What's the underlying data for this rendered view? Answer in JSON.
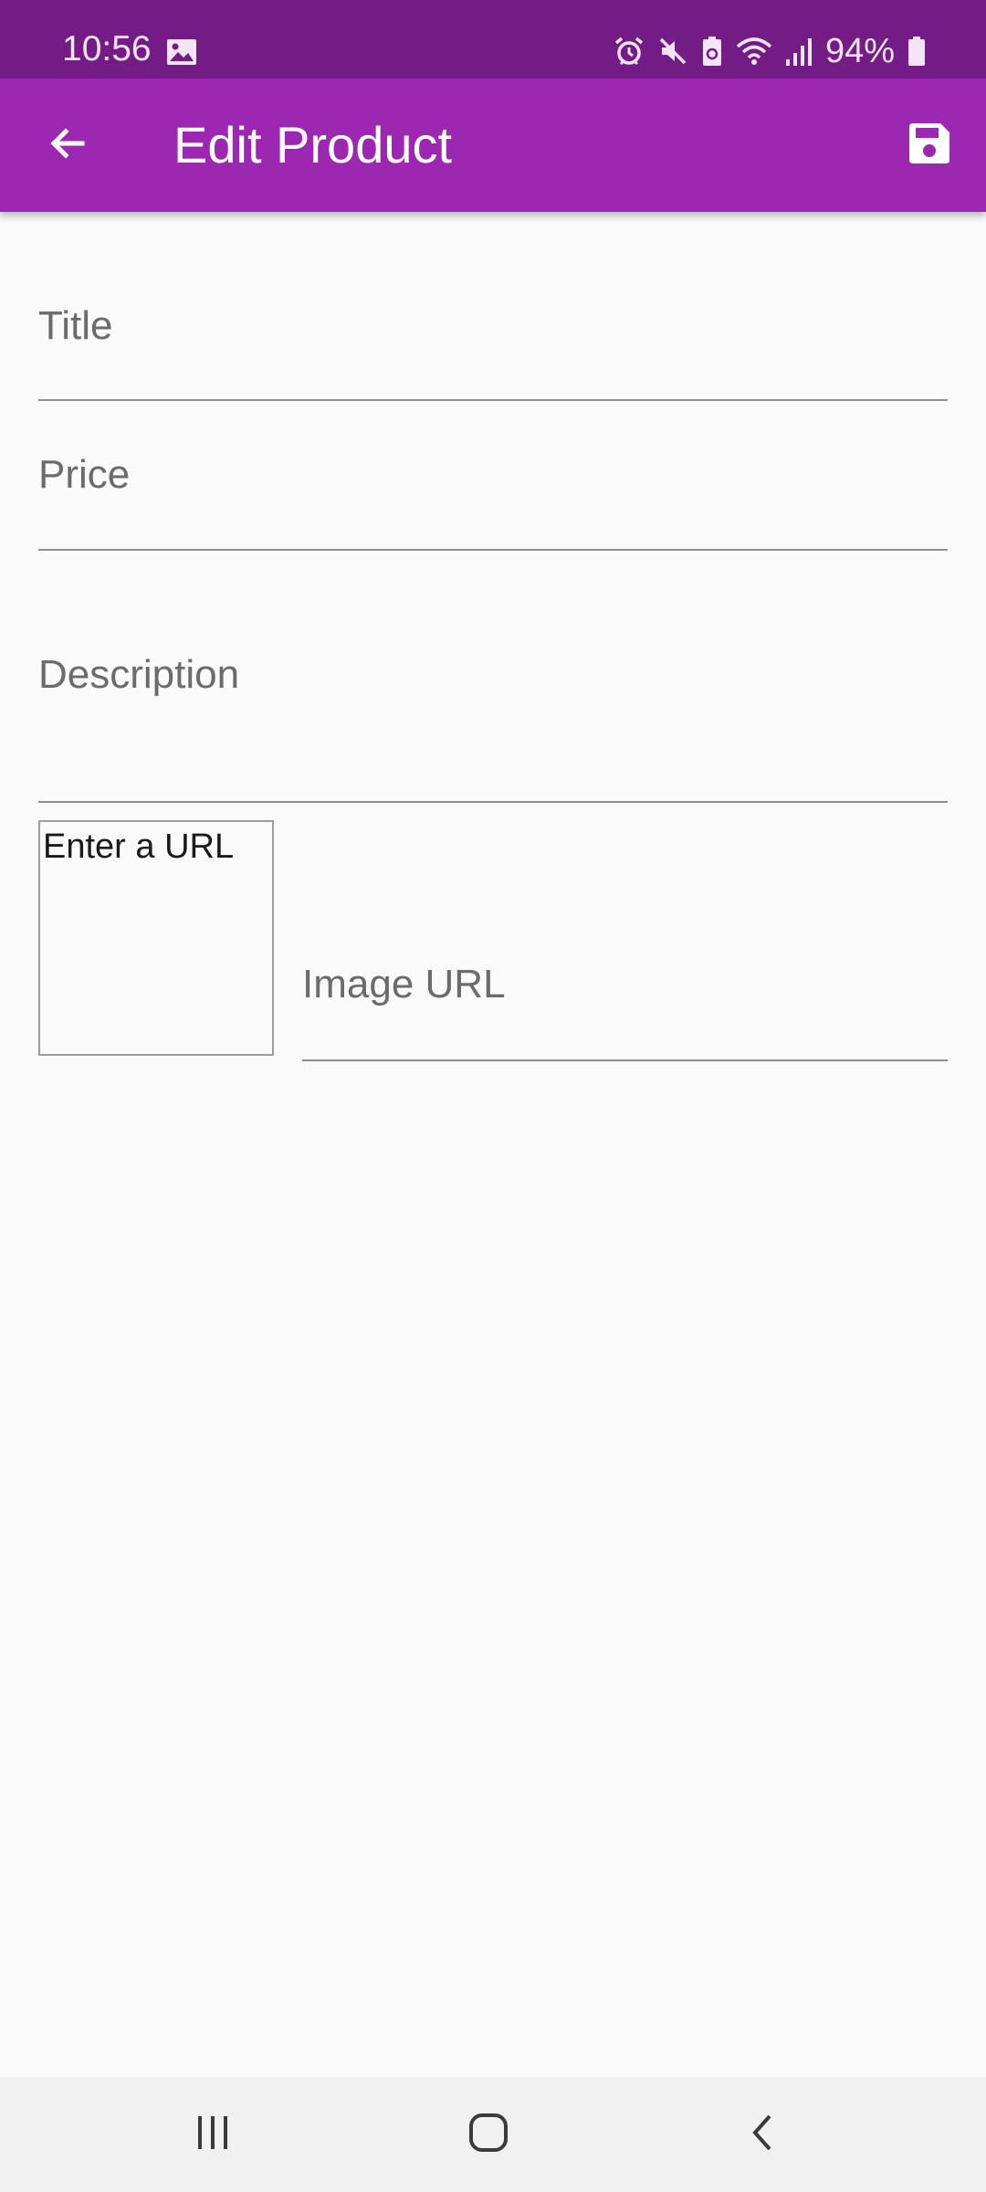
{
  "status_bar": {
    "time": "10:56",
    "battery_percent": "94%",
    "icons": [
      "gallery-icon",
      "alarm-icon",
      "mute-icon",
      "battery-saver-icon",
      "wifi-icon",
      "signal-icon",
      "battery-icon"
    ]
  },
  "app_bar": {
    "title": "Edit Product",
    "back_icon": "arrow-back-icon",
    "save_icon": "save-icon",
    "color": "#9c27b0",
    "status_color": "#741c85"
  },
  "form": {
    "title_label": "Title",
    "price_label": "Price",
    "description_label": "Description",
    "image_preview_text": "Enter a URL",
    "image_url_label": "Image URL"
  },
  "nav_bar": {
    "icons": [
      "recent-apps-icon",
      "home-icon",
      "back-icon"
    ]
  }
}
